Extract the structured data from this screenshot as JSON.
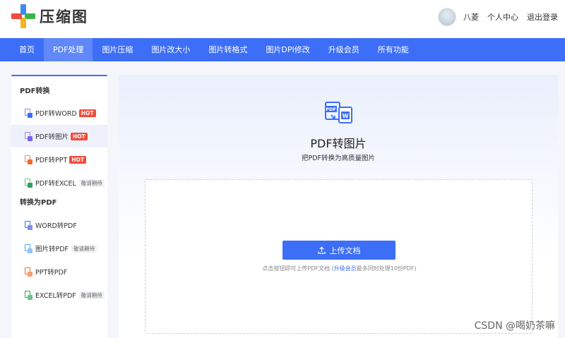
{
  "header": {
    "logo_text": "压缩图",
    "username": "八菱",
    "account_link": "个人中心",
    "logout_link": "退出登录"
  },
  "nav": {
    "items": [
      "首页",
      "PDF处理",
      "图片压缩",
      "图片改大小",
      "图片转格式",
      "图片DPI修改",
      "升级会员",
      "所有功能"
    ],
    "active_index": 1
  },
  "sidebar": {
    "group1_title": "PDF转换",
    "group1_items": [
      {
        "label": "PDF转WORD",
        "tag": "HOT"
      },
      {
        "label": "PDF转图片",
        "tag": "HOT"
      },
      {
        "label": "PDF转PPT",
        "tag": "HOT"
      },
      {
        "label": "PDF转EXCEL",
        "tag": "敬请期待"
      }
    ],
    "group2_title": "转换为PDF",
    "group2_items": [
      {
        "label": "WORD转PDF",
        "tag": ""
      },
      {
        "label": "图片转PDF",
        "tag": "敬请期待"
      },
      {
        "label": "PPT转PDF",
        "tag": ""
      },
      {
        "label": "EXCEL转PDF",
        "tag": "敬请期待"
      }
    ]
  },
  "main": {
    "title": "PDF转图片",
    "subtitle": "把PDF转换为高质量图片",
    "upload_button": "上传文档",
    "hint_before": "点击按钮即可上传PDF文档 (",
    "hint_vip": "升级会员",
    "hint_after": "最多同时处理10份PDF)"
  },
  "watermark": "CSDN @喝奶茶嘛",
  "colors": {
    "primary": "#3d6ef7",
    "hot": "#f24b3c"
  }
}
